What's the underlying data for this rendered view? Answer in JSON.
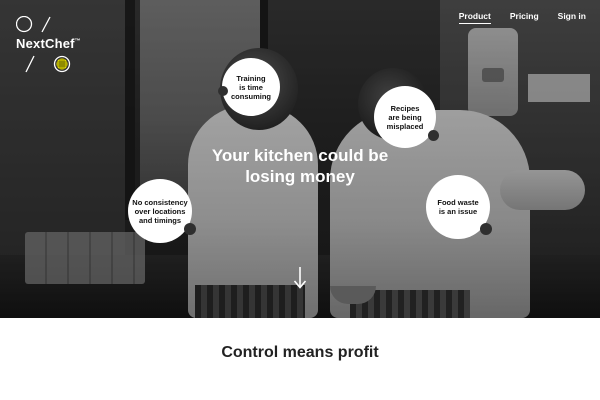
{
  "brand": {
    "name": "NextChef",
    "trademark": "™"
  },
  "nav": {
    "items": [
      {
        "label": "Product",
        "active": true
      },
      {
        "label": "Pricing",
        "active": false
      },
      {
        "label": "Sign in",
        "active": false
      }
    ]
  },
  "hero": {
    "headline_line1": "Your kitchen could be",
    "headline_line2": "losing money",
    "bubbles": {
      "training": "Training\nis time\nconsuming",
      "recipes": "Recipes\nare being\nmisplaced",
      "consistency": "No consistency\nover locations\nand timings",
      "waste": "Food waste\nis an issue"
    },
    "scroll_icon": "arrow-down-icon"
  },
  "section": {
    "tagline_plain": "Control means ",
    "tagline_bold": "profit"
  },
  "colors": {
    "text_light": "#ffffff",
    "text_dark": "#222222",
    "logo_accent": "#e8e000"
  }
}
